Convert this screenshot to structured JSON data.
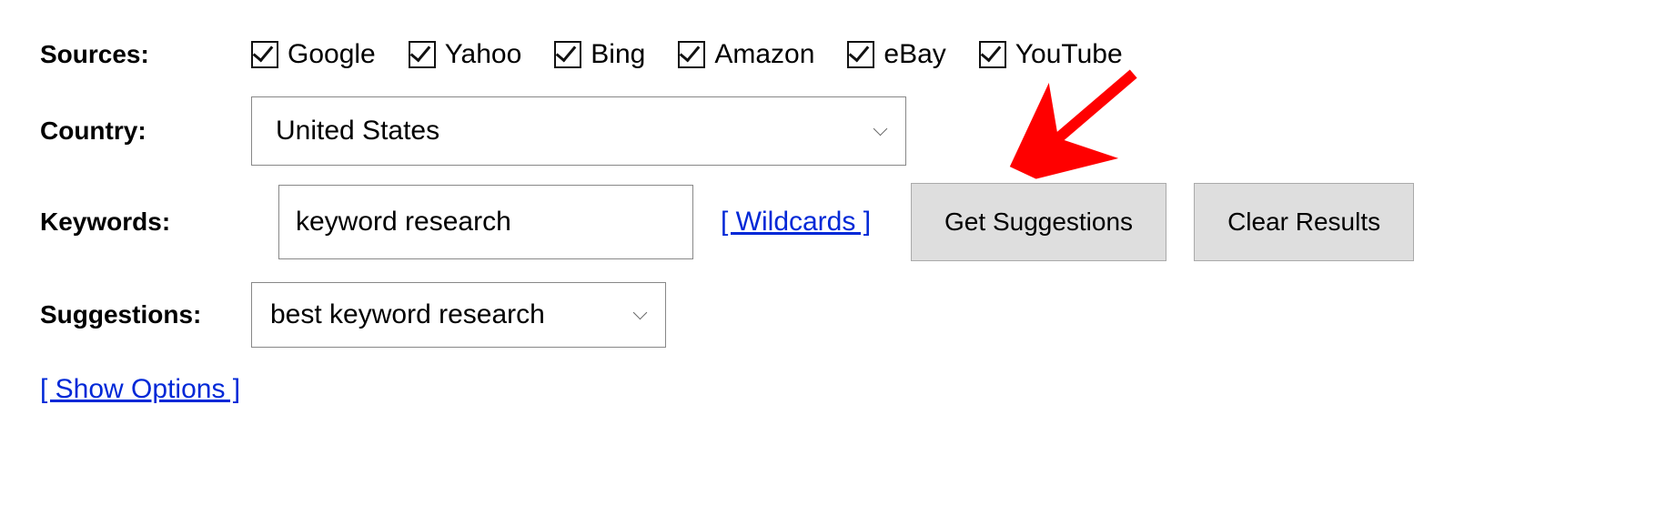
{
  "labels": {
    "sources": "Sources:",
    "country": "Country:",
    "keywords": "Keywords:",
    "suggestions": "Suggestions:"
  },
  "sources": {
    "google": {
      "label": "Google",
      "checked": true
    },
    "yahoo": {
      "label": "Yahoo",
      "checked": true
    },
    "bing": {
      "label": "Bing",
      "checked": true
    },
    "amazon": {
      "label": "Amazon",
      "checked": true
    },
    "ebay": {
      "label": "eBay",
      "checked": true
    },
    "youtube": {
      "label": "YouTube",
      "checked": true
    }
  },
  "country": {
    "selected": "United States"
  },
  "keywords": {
    "value": "keyword research"
  },
  "links": {
    "wildcards": "[ Wildcards ]",
    "show_options": "[ Show Options ]"
  },
  "buttons": {
    "get_suggestions": "Get Suggestions",
    "clear_results": "Clear Results"
  },
  "suggestions": {
    "selected": "best keyword research"
  }
}
